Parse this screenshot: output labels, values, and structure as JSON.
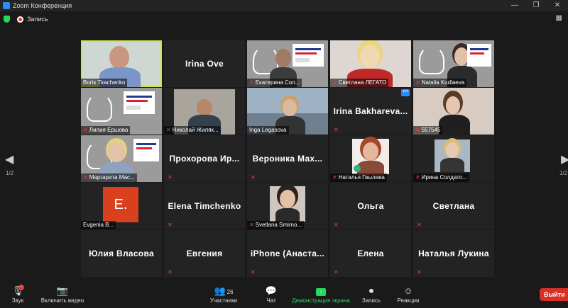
{
  "window": {
    "title": "Zoom Конференция"
  },
  "recording": {
    "label": "Запись"
  },
  "pager": {
    "left": "1/2",
    "right": "1/2"
  },
  "tiles": [
    {
      "id": "t1",
      "name": "Boris Tkachenko"
    },
    {
      "id": "t2",
      "name": "Irina Ove"
    },
    {
      "id": "t3",
      "name": "Екатерина Сол..."
    },
    {
      "id": "t4",
      "name": "Светлана ЛЕГАТО"
    },
    {
      "id": "t5",
      "name": "Natalia Kudlaeva"
    },
    {
      "id": "t6",
      "name": "Лилия Ершова"
    },
    {
      "id": "t7",
      "name": "Николай Жиляк..."
    },
    {
      "id": "t8",
      "name": "Inga Legasova"
    },
    {
      "id": "t9",
      "name": "Irina Bakhareva..."
    },
    {
      "id": "t10",
      "name": "557545"
    },
    {
      "id": "t11",
      "name": "Маргарита Мас..."
    },
    {
      "id": "t12",
      "name": "Прохорова Ир..."
    },
    {
      "id": "t13",
      "name": "Вероника Мах..."
    },
    {
      "id": "t14",
      "name": "Наталья Гвылева"
    },
    {
      "id": "t15",
      "name": "Ирина Солдато..."
    },
    {
      "id": "t16",
      "name": "Evgenia B..."
    },
    {
      "id": "t17",
      "name": "Elena Timchenko"
    },
    {
      "id": "t18",
      "name": "Svetlana Smirno..."
    },
    {
      "id": "t19",
      "name": "Ольга"
    },
    {
      "id": "t20",
      "name": "Светлана"
    },
    {
      "id": "t21",
      "name": "Юлия Власова"
    },
    {
      "id": "t22",
      "name": "Евгения"
    },
    {
      "id": "t23",
      "name": "iPhone (Анаста..."
    },
    {
      "id": "t24",
      "name": "Елена"
    },
    {
      "id": "t25",
      "name": "Наталья Лукина"
    }
  ],
  "avatar_letter": "E.",
  "toolbar": {
    "audio": "Звук",
    "video": "Включить видео",
    "participants": "Участники",
    "participants_count": "26",
    "chat": "Чат",
    "share": "Демонстрация экрана",
    "record": "Запись",
    "reactions": "Реакции",
    "leave": "Выйти"
  },
  "colors": {
    "share_green": "#23d959",
    "active_border": "#c8e93b",
    "leave_red": "#d93025",
    "muted_red": "#e0413a",
    "avatar_orange": "#d9401e"
  }
}
